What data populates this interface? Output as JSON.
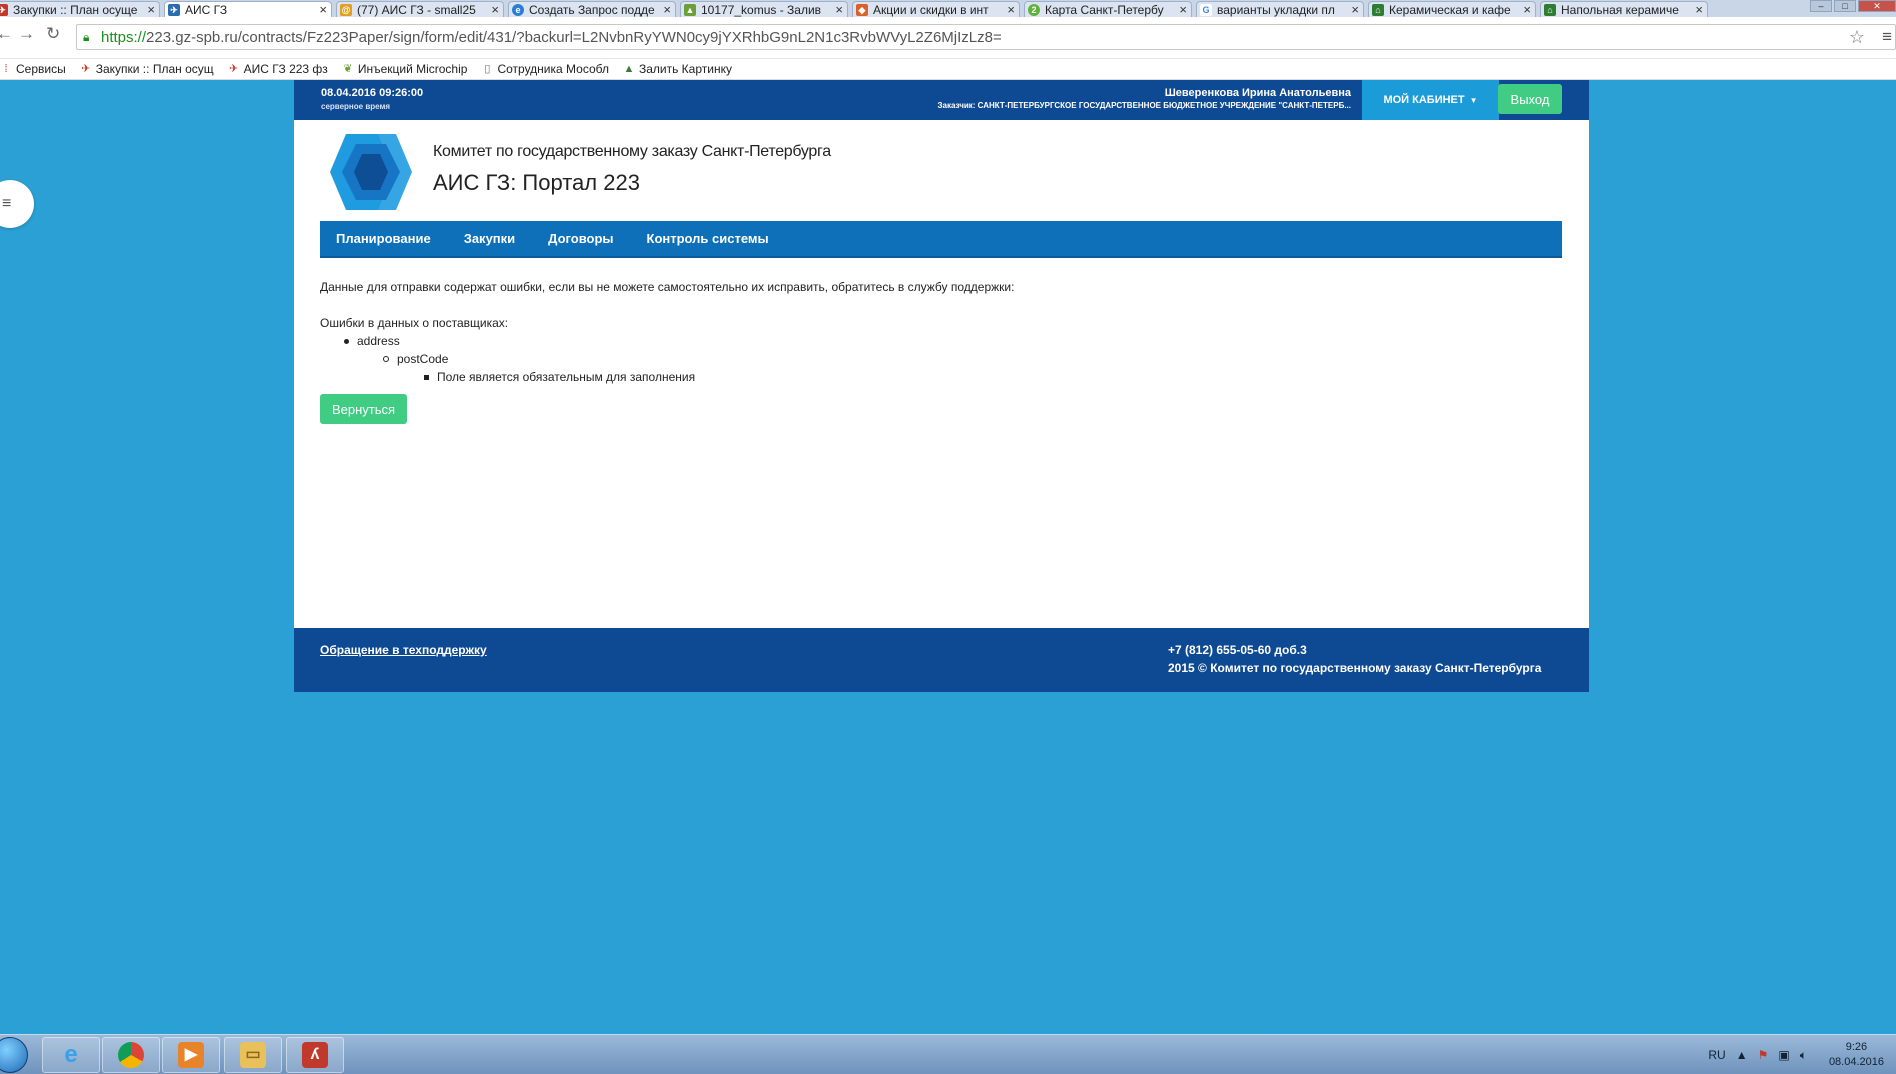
{
  "browser": {
    "tabs": [
      {
        "label": "Закупки :: План осуще",
        "icon": "zakupki-icon",
        "color": "#c0392b",
        "active": false
      },
      {
        "label": "АИС ГЗ",
        "icon": "ais-icon",
        "color": "#2b6cb0",
        "active": true
      },
      {
        "label": "(77) АИС ГЗ - small25",
        "icon": "at-icon",
        "color": "#e0a020",
        "active": false
      },
      {
        "label": "Создать Запрос подде",
        "icon": "globe-icon",
        "color": "#2a7fd4",
        "active": false
      },
      {
        "label": "10177_komus - Залив",
        "icon": "image-icon",
        "color": "#6a9f3a",
        "active": false
      },
      {
        "label": "Акции и скидки в инт",
        "icon": "tag-icon",
        "color": "#d9622b",
        "active": false
      },
      {
        "label": "Карта Санкт-Петербу",
        "icon": "2gis-icon",
        "color": "#5eb33b",
        "active": false
      },
      {
        "label": "варианты укладки пл",
        "icon": "google-icon",
        "color": "#4285f4",
        "active": false
      },
      {
        "label": "Керамическая и кафе",
        "icon": "house-icon",
        "color": "#2e7d32",
        "active": false
      },
      {
        "label": "Напольная керамиче",
        "icon": "house-icon",
        "color": "#2e7d32",
        "active": false
      }
    ],
    "url_secure": "https://",
    "url_rest": "223.gz-spb.ru/contracts/Fz223Paper/sign/form/edit/431/?backurl=L2NvbnRyYWN0cy9jYXRhbG9nL2N1c3RvbWVyL2Z6MjIzLz8=",
    "bookmarks": [
      {
        "label": "Сервисы",
        "icon": "apps-icon"
      },
      {
        "label": "Закупки :: План осущ",
        "icon": "zakupki-icon"
      },
      {
        "label": "АИС ГЗ 223 фз",
        "icon": "zakupki-icon"
      },
      {
        "label": "Инъекций Microchip",
        "icon": "leaf-icon"
      },
      {
        "label": "Сотрудника Мособл",
        "icon": "page-icon"
      },
      {
        "label": "Залить Картинку",
        "icon": "image-icon"
      }
    ]
  },
  "header": {
    "datetime": "08.04.2016 09:26:00",
    "server_time": "серверное время",
    "user": "Шеверенкова Ирина Анатольевна",
    "customer": "Заказчик: САНКТ-ПЕТЕРБУРГСКОЕ ГОСУДАРСТВЕННОЕ БЮДЖЕТНОЕ УЧРЕЖДЕНИЕ \"САНКТ-ПЕТЕРБ...",
    "cabinet": "МОЙ КАБИНЕТ",
    "logout": "Выход",
    "org": "Комитет по государственному заказу Санкт-Петербурга",
    "portal": "АИС ГЗ: Портал 223"
  },
  "nav": [
    "Планирование",
    "Закупки",
    "Договоры",
    "Контроль системы"
  ],
  "content": {
    "message": "Данные для отправки содержат ошибки, если вы не можете самостоятельно их исправить, обратитесь в службу поддержки:",
    "errors_title": "Ошибки в данных о поставщиках:",
    "field": "address",
    "subfield": "postCode",
    "error": "Поле является обязательным для заполнения",
    "back": "Вернуться"
  },
  "footer": {
    "support": "Обращение в техподдержку",
    "phone": "+7 (812) 655-05-60 доб.3",
    "copyright": "2015 © Комитет по государственному заказу Санкт-Петербурга"
  },
  "taskbar": {
    "lang": "RU",
    "time": "9:26",
    "date": "08.04.2016"
  },
  "colors": {
    "background": "#2aa0d4",
    "header": "#0e4a93",
    "nav": "#0d70b8",
    "accent_button": "#40cc82",
    "cabinet": "#1c9bd9"
  }
}
